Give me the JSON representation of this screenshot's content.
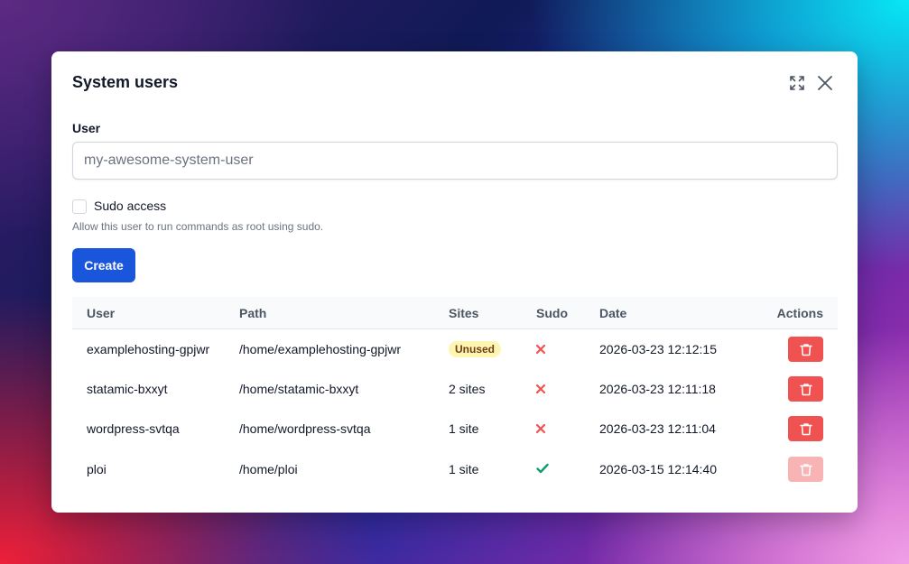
{
  "modal": {
    "title": "System users"
  },
  "form": {
    "user_label": "User",
    "user_placeholder": "my-awesome-system-user",
    "user_value": "",
    "sudo_label": "Sudo access",
    "sudo_checked": false,
    "sudo_help": "Allow this user to run commands as root using sudo.",
    "create_label": "Create",
    "create_color": "#1a56db"
  },
  "table": {
    "headers": {
      "user": "User",
      "path": "Path",
      "sites": "Sites",
      "sudo": "Sudo",
      "date": "Date",
      "actions": "Actions"
    },
    "rows": [
      {
        "user": "examplehosting-gpjwr",
        "path": "/home/examplehosting-gpjwr",
        "sites": "Unused",
        "sites_badge": true,
        "sudo": false,
        "date": "2026-03-23 12:12:15",
        "delete_enabled": true
      },
      {
        "user": "statamic-bxxyt",
        "path": "/home/statamic-bxxyt",
        "sites": "2 sites",
        "sites_badge": false,
        "sudo": false,
        "date": "2026-03-23 12:11:18",
        "delete_enabled": true
      },
      {
        "user": "wordpress-svtqa",
        "path": "/home/wordpress-svtqa",
        "sites": "1 site",
        "sites_badge": false,
        "sudo": false,
        "date": "2026-03-23 12:11:04",
        "delete_enabled": true
      },
      {
        "user": "ploi",
        "path": "/home/ploi",
        "sites": "1 site",
        "sites_badge": false,
        "sudo": true,
        "date": "2026-03-15 12:14:40",
        "delete_enabled": false
      }
    ]
  },
  "colors": {
    "danger": "#f05252",
    "danger_disabled": "#f8b4b4",
    "success": "#0e9f6e",
    "badge_bg": "#fdf6b2",
    "badge_text": "#723b13"
  },
  "icons": {
    "expand": "expand-icon",
    "close": "close-icon",
    "sudo_no": "x-mark-icon",
    "sudo_yes": "check-icon",
    "delete": "trash-icon"
  }
}
